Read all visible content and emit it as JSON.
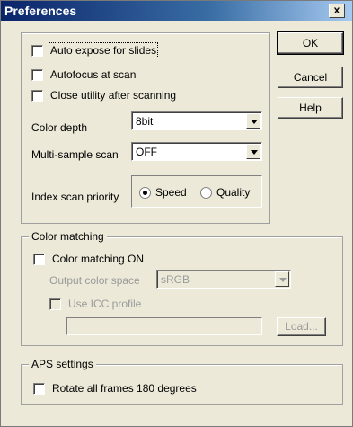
{
  "window": {
    "title": "Preferences",
    "close_symbol": "x"
  },
  "buttons": {
    "ok": "OK",
    "cancel": "Cancel",
    "help": "Help"
  },
  "scan_options": {
    "auto_expose_slides": {
      "label": "Auto expose for slides",
      "checked": false
    },
    "autofocus_scan": {
      "label": "Autofocus at scan",
      "checked": false
    },
    "close_utility": {
      "label": "Close utility after scanning",
      "checked": false
    },
    "color_depth": {
      "label": "Color depth",
      "value": "8bit"
    },
    "multi_sample": {
      "label": "Multi-sample scan",
      "value": "OFF"
    },
    "index_priority": {
      "label": "Index scan priority",
      "options": [
        "Speed",
        "Quality"
      ],
      "selected": "Speed"
    }
  },
  "color_matching": {
    "legend": "Color matching",
    "enable": {
      "label": "Color matching ON",
      "checked": false
    },
    "output_space": {
      "label": "Output color space",
      "value": "sRGB"
    },
    "icc_profile": {
      "label": "Use ICC profile",
      "checked": false
    },
    "profile_path": "",
    "load_button": "Load..."
  },
  "aps": {
    "legend": "APS settings",
    "rotate": {
      "label": "Rotate all frames 180 degrees",
      "checked": false
    }
  }
}
